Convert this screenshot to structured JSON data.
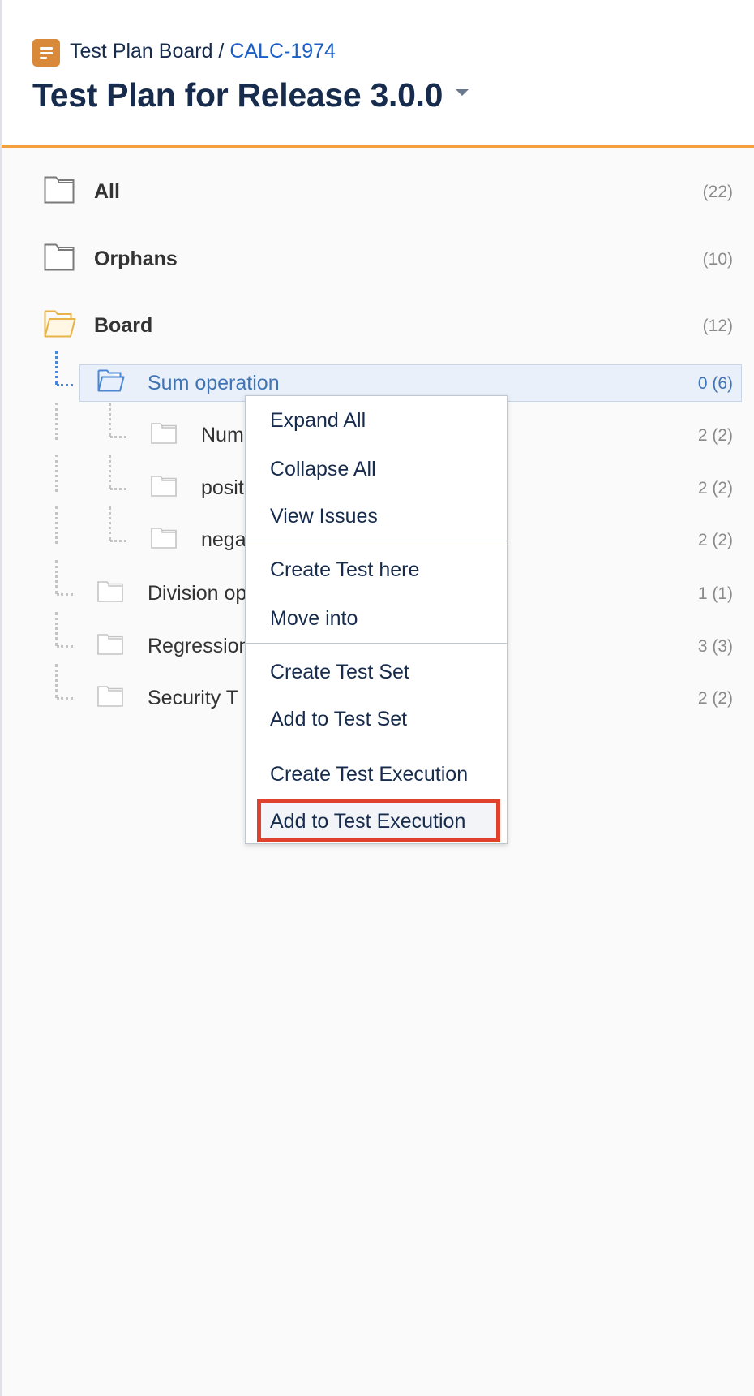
{
  "header": {
    "breadcrumb_prefix": "Test Plan Board / ",
    "breadcrumb_link": "CALC-1974",
    "title": "Test Plan for Release 3.0.0",
    "icon": "test-plan-icon",
    "caret_icon": "caret-down-icon"
  },
  "tree": {
    "items": [
      {
        "label": "All",
        "count": "(22)"
      },
      {
        "label": "Orphans",
        "count": "(10)"
      },
      {
        "label": "Board",
        "count": "(12)"
      },
      {
        "label": "Sum operation",
        "count": "0 (6)"
      },
      {
        "label": "Num",
        "count": "2 (2)"
      },
      {
        "label": "posit",
        "count": "2 (2)"
      },
      {
        "label": "nega",
        "count": "2 (2)"
      },
      {
        "label": "Division op",
        "count": "1 (1)"
      },
      {
        "label": "Regression",
        "count": "3 (3)"
      },
      {
        "label": "Security T",
        "count": "2 (2)"
      }
    ]
  },
  "context_menu": {
    "items": [
      "Expand All",
      "Collapse All",
      "View Issues",
      "Create Test here",
      "Move into",
      "Create Test Set",
      "Add to Test Set",
      "Create Test Execution",
      "Add to Test Execution"
    ]
  },
  "colors": {
    "accent_orange": "#f4a03d",
    "link_blue": "#1a5ec6",
    "selected_blue": "#3f74b5",
    "highlight_red": "#e0412d",
    "folder_yellow": "#e8b34a"
  }
}
